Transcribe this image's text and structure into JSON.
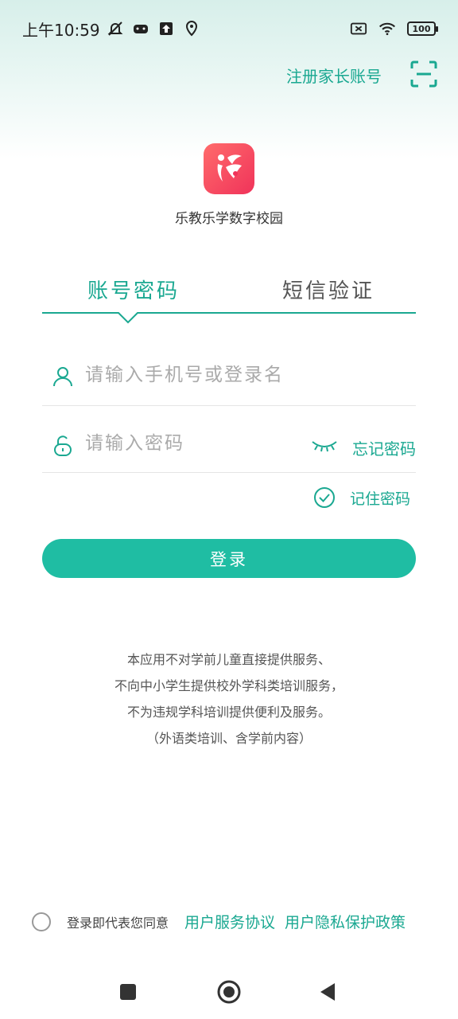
{
  "status_bar": {
    "time": "上午10:59",
    "battery": "100"
  },
  "header": {
    "register_label": "注册家长账号"
  },
  "app": {
    "name": "乐教乐学数字校园"
  },
  "tabs": [
    {
      "label": "账号密码",
      "active": true
    },
    {
      "label": "短信验证",
      "active": false
    }
  ],
  "form": {
    "username_placeholder": "请输入手机号或登录名",
    "username_value": "",
    "password_placeholder": "请输入密码",
    "password_value": "",
    "forgot_label": "忘记密码",
    "remember_label": "记住密码",
    "remember_checked": true,
    "login_label": "登录"
  },
  "notice": {
    "line1": "本应用不对学前儿童直接提供服务、",
    "line2": "不向中小学生提供校外学科类培训服务，",
    "line3": "不为违规学科培训提供便利及服务。",
    "line4": "（外语类培训、含学前内容）"
  },
  "agreement": {
    "text": "登录即代表您同意",
    "service_link": "用户服务协议",
    "privacy_link": "用户隐私保护政策",
    "checked": false
  },
  "colors": {
    "accent": "#1aa891",
    "button": "#1fbda3",
    "logo": "#f0335a"
  }
}
